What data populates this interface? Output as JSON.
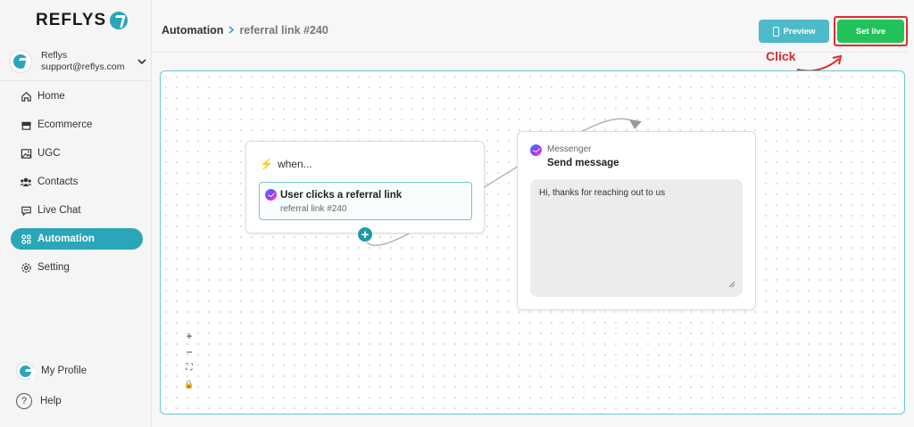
{
  "brand": {
    "name": "REFLYS",
    "color": "#2aa6b8"
  },
  "account": {
    "name": "Reflys",
    "email": "support@reflys.com"
  },
  "sidebar": {
    "items": [
      {
        "label": "Home",
        "icon": "home-icon"
      },
      {
        "label": "Ecommerce",
        "icon": "store-icon"
      },
      {
        "label": "UGC",
        "icon": "image-icon"
      },
      {
        "label": "Contacts",
        "icon": "users-icon"
      },
      {
        "label": "Live Chat",
        "icon": "chat-icon"
      },
      {
        "label": "Automation",
        "icon": "automation-icon",
        "active": true
      },
      {
        "label": "Setting",
        "icon": "gear-icon"
      }
    ],
    "profile_label": "My Profile",
    "help_label": "Help"
  },
  "header": {
    "breadcrumb_root": "Automation",
    "breadcrumb_current": "referral link #240",
    "preview_label": "Preview",
    "set_live_label": "Set live"
  },
  "annotation": {
    "click_label": "Click",
    "color": "#d92a2a"
  },
  "flow": {
    "trigger": {
      "title": "when...",
      "event": "User clicks a referral link",
      "detail": "referral link #240"
    },
    "action": {
      "channel": "Messenger",
      "title": "Send message",
      "message": "Hi, thanks for reaching out to us"
    }
  },
  "zoom_controls": [
    "+",
    "−",
    "⛶",
    "🔒"
  ],
  "colors": {
    "accent": "#2aa6b8",
    "live": "#22c25a",
    "highlight": "#e02b2b"
  }
}
